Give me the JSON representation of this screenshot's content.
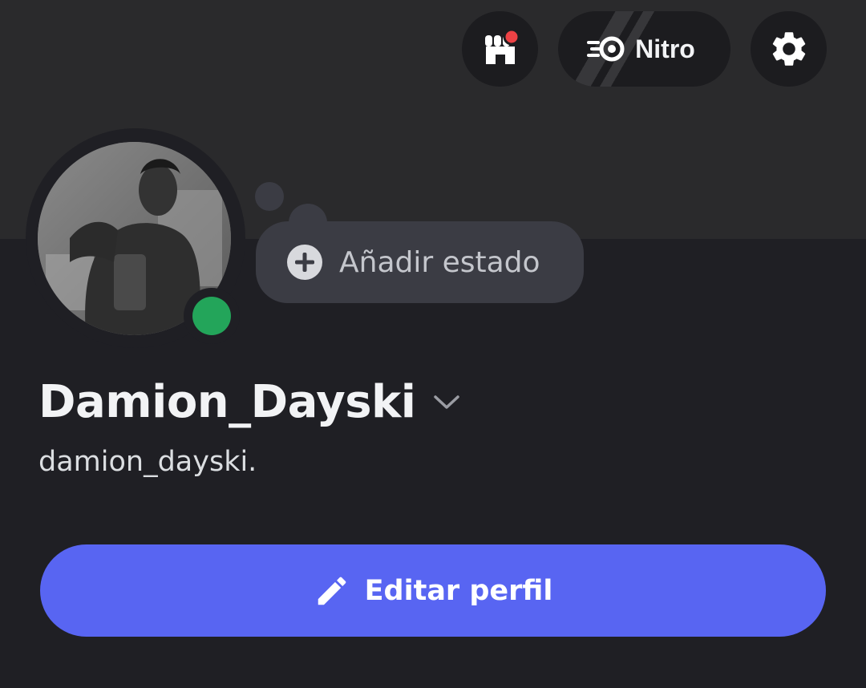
{
  "header": {
    "shop_icon": "shop-icon",
    "shop_has_notification": true,
    "nitro_label": "Nitro",
    "nitro_icon": "nitro-icon",
    "settings_icon": "gear-icon"
  },
  "profile": {
    "avatar_alt": "profile-photo",
    "presence": "online",
    "presence_color": "#23a55a",
    "status_prompt": "Añadir estado",
    "display_name": "Damion_Dayski",
    "username": "damion_dayski."
  },
  "actions": {
    "edit_profile_label": "Editar perfil",
    "edit_profile_icon": "pencil-icon"
  },
  "colors": {
    "background": "#1f1f24",
    "banner": "#2a2a2c",
    "accent": "#5865f2",
    "pill": "#3b3c44",
    "notification": "#ed4245"
  }
}
